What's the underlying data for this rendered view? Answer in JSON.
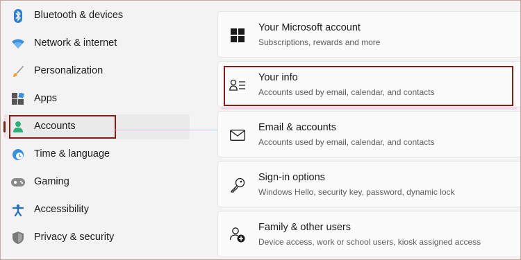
{
  "sidebar": {
    "items": [
      {
        "label": "Bluetooth & devices",
        "icon": "bluetooth-icon"
      },
      {
        "label": "Network & internet",
        "icon": "wifi-icon"
      },
      {
        "label": "Personalization",
        "icon": "brush-icon"
      },
      {
        "label": "Apps",
        "icon": "apps-icon"
      },
      {
        "label": "Accounts",
        "icon": "person-icon",
        "selected": true
      },
      {
        "label": "Time & language",
        "icon": "globe-clock-icon"
      },
      {
        "label": "Gaming",
        "icon": "gamepad-icon"
      },
      {
        "label": "Accessibility",
        "icon": "accessibility-icon"
      },
      {
        "label": "Privacy & security",
        "icon": "shield-icon"
      }
    ]
  },
  "main": {
    "cards": [
      {
        "title": "Your Microsoft account",
        "subtitle": "Subscriptions, rewards and more",
        "icon": "windows-logo-icon"
      },
      {
        "title": "Your info",
        "subtitle": "Accounts used by email, calendar, and contacts",
        "icon": "person-info-icon",
        "highlighted": true
      },
      {
        "title": "Email & accounts",
        "subtitle": "Accounts used by email, calendar, and contacts",
        "icon": "mail-icon"
      },
      {
        "title": "Sign-in options",
        "subtitle": "Windows Hello, security key, password, dynamic lock",
        "icon": "key-icon"
      },
      {
        "title": "Family & other users",
        "subtitle": "Device access, work or school users, kiosk assigned access",
        "icon": "person-add-icon"
      }
    ]
  },
  "colors": {
    "accent": "#7a1d12",
    "annotation_box": "#8b1a10",
    "annotation_highlight": "#ffa0d2"
  }
}
